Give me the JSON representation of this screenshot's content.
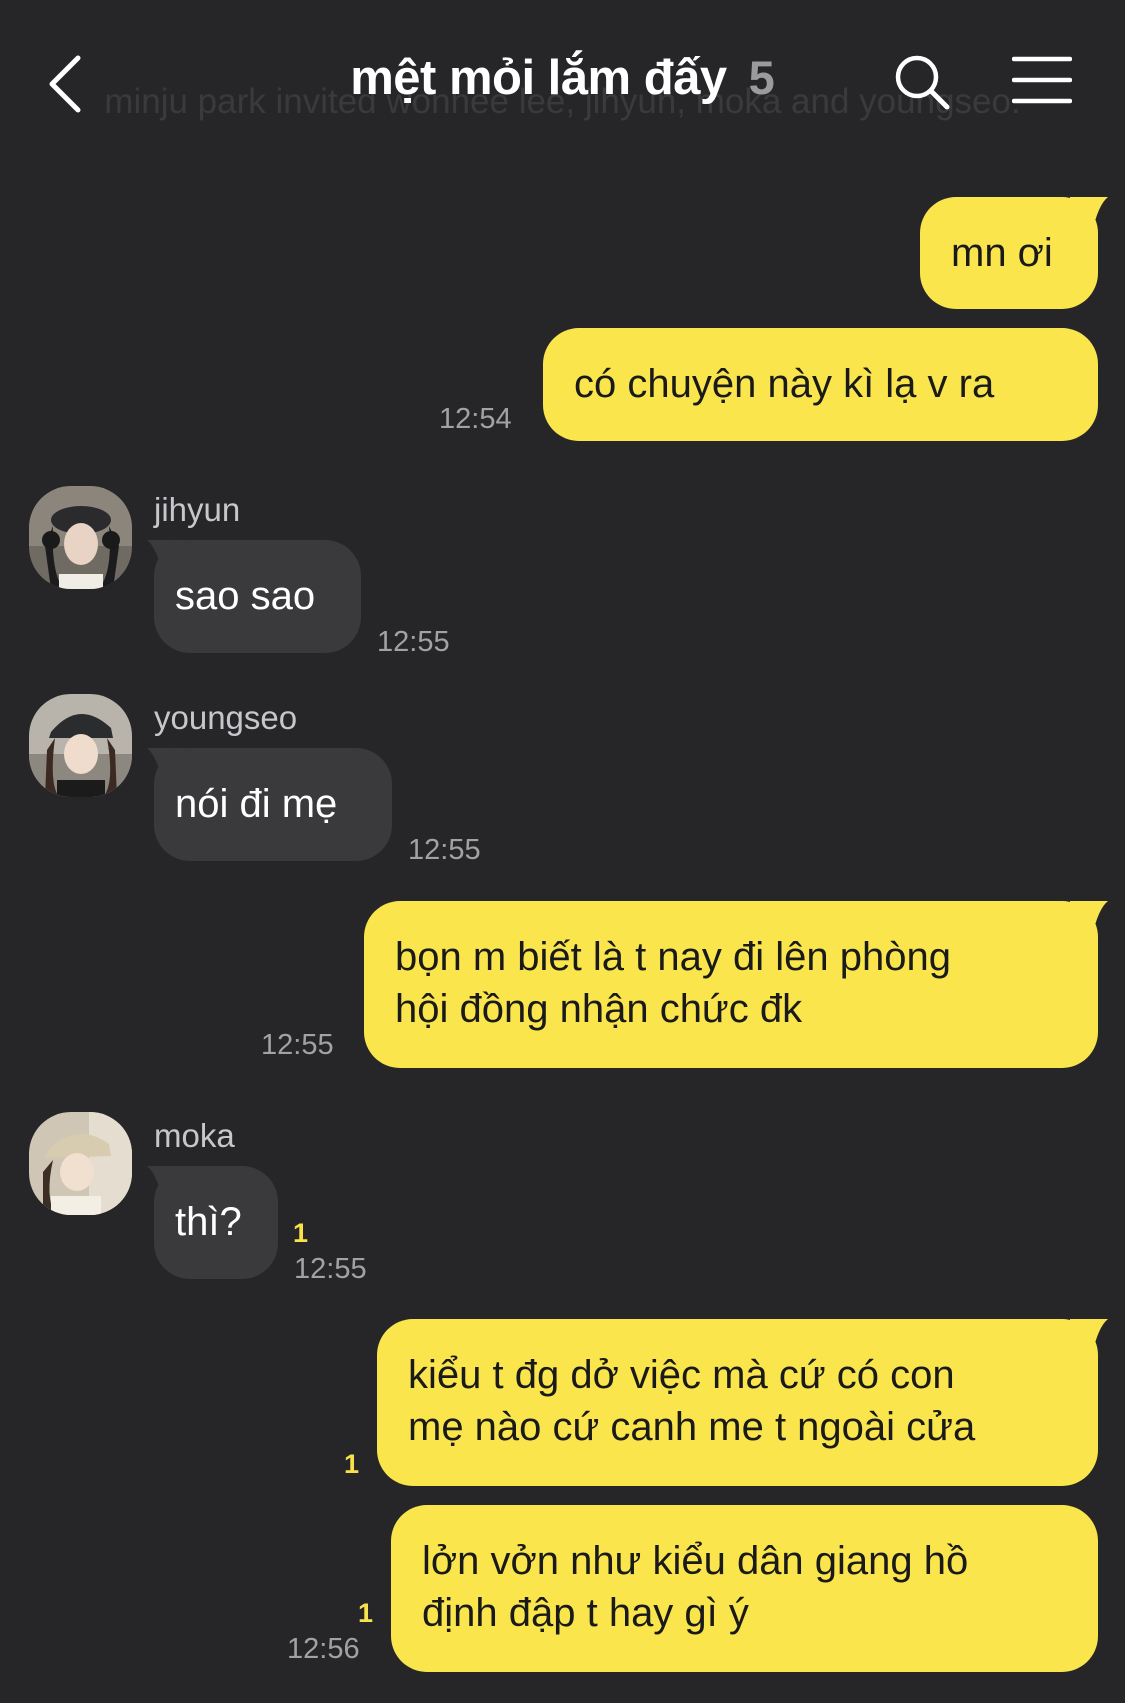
{
  "header": {
    "title": "mệt mỏi lắm đấy",
    "member_count": "5",
    "system_notice": "minju park invited wonhee lee, jihyun, moka and youngseo."
  },
  "messages": {
    "m1": {
      "text": "mn ơi"
    },
    "m2": {
      "text": "có chuyện này kì lạ v ra",
      "time": "12:54"
    },
    "m3": {
      "sender": "jihyun",
      "text": "sao sao",
      "time": "12:55"
    },
    "m4": {
      "sender": "youngseo",
      "text": "nói đi mẹ",
      "time": "12:55"
    },
    "m5": {
      "lines": [
        "bọn m biết là t nay đi lên phòng",
        "hội đồng nhận chức đk"
      ],
      "time": "12:55"
    },
    "m6": {
      "sender": "moka",
      "text": "thì?",
      "unread": "1",
      "time": "12:55"
    },
    "m7": {
      "lines": [
        "kiểu t đg dở việc mà cứ có con",
        "mẹ nào cứ canh me t ngoài cửa"
      ],
      "unread": "1"
    },
    "m8": {
      "lines": [
        "lởn vởn như kiểu dân giang hồ",
        "định đập t hay gì ý"
      ],
      "unread": "1",
      "time": "12:56"
    }
  },
  "colors": {
    "background": "#262628",
    "outgoing_bubble": "#fae64c",
    "incoming_bubble": "#3a3a3c",
    "unread_badge": "#f7e24b"
  },
  "icons": [
    "back-arrow-icon",
    "search-icon",
    "menu-icon"
  ]
}
